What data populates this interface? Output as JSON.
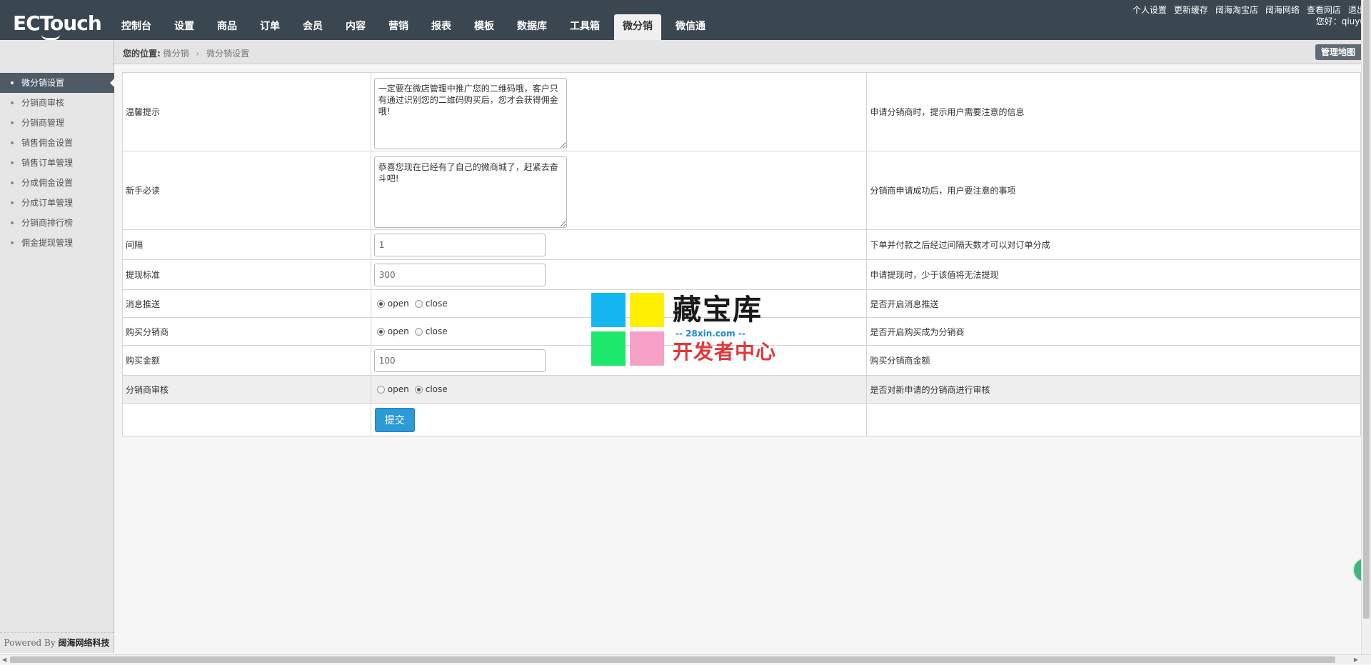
{
  "app": {
    "logo_text": "ECTouch"
  },
  "nav": {
    "items": [
      {
        "label": "控制台"
      },
      {
        "label": "设置"
      },
      {
        "label": "商品"
      },
      {
        "label": "订单"
      },
      {
        "label": "会员"
      },
      {
        "label": "内容"
      },
      {
        "label": "营销"
      },
      {
        "label": "报表"
      },
      {
        "label": "模板"
      },
      {
        "label": "数据库"
      },
      {
        "label": "工具箱"
      },
      {
        "label": "微分销",
        "active": true
      },
      {
        "label": "微信通"
      }
    ]
  },
  "top_links": [
    "个人设置",
    "更新缓存",
    "阔海淘宝店",
    "阔海网络",
    "查看网店",
    "退出"
  ],
  "greeting": "您好：qiuyu",
  "breadcrumb": {
    "label": "您的位置:",
    "items": [
      "微分销",
      "微分销设置"
    ]
  },
  "sitemap_button": "管理地图",
  "sidebar": {
    "items": [
      {
        "label": "微分销设置",
        "active": true
      },
      {
        "label": "分销商审核"
      },
      {
        "label": "分销商管理"
      },
      {
        "label": "销售佣金设置"
      },
      {
        "label": "销售订单管理"
      },
      {
        "label": "分成佣金设置"
      },
      {
        "label": "分成订单管理"
      },
      {
        "label": "分销商排行榜"
      },
      {
        "label": "佣金提现管理"
      }
    ],
    "powered_prefix": "Powered By",
    "powered_brand": "阔海网络科技"
  },
  "form": {
    "rows": [
      {
        "label": "温馨提示",
        "value": "一定要在微店管理中推广您的二维码哦，客户只有通过识别您的二维码购买后，您才会获得佣金哦!",
        "note": "申请分销商时，提示用户需要注意的信息"
      },
      {
        "label": "新手必读",
        "value": "恭喜您现在已经有了自己的微商城了，赶紧去奋斗吧!",
        "note": "分销商申请成功后，用户要注意的事项"
      },
      {
        "label": "间隔",
        "value": "1",
        "note": "下单并付款之后经过间隔天数才可以对订单分成"
      },
      {
        "label": "提现标准",
        "value": "300",
        "note": "申请提现时，少于该值将无法提现"
      },
      {
        "label": "消息推送",
        "option_open": "open",
        "option_close": "close",
        "selected": "open",
        "note": "是否开启消息推送"
      },
      {
        "label": "购买分销商",
        "option_open": "open",
        "option_close": "close",
        "selected": "open",
        "note": "是否开启购买成为分销商"
      },
      {
        "label": "购买金额",
        "value": "100",
        "note": "购买分销商金额"
      },
      {
        "label": "分销商审核",
        "option_open": "open",
        "option_close": "close",
        "selected": "close",
        "note": "是否对新申请的分销商进行审核"
      }
    ],
    "submit_label": "提交"
  },
  "watermark": {
    "title": "藏宝库",
    "url": "-- 28xin.com --",
    "subtitle": "开发者中心"
  }
}
